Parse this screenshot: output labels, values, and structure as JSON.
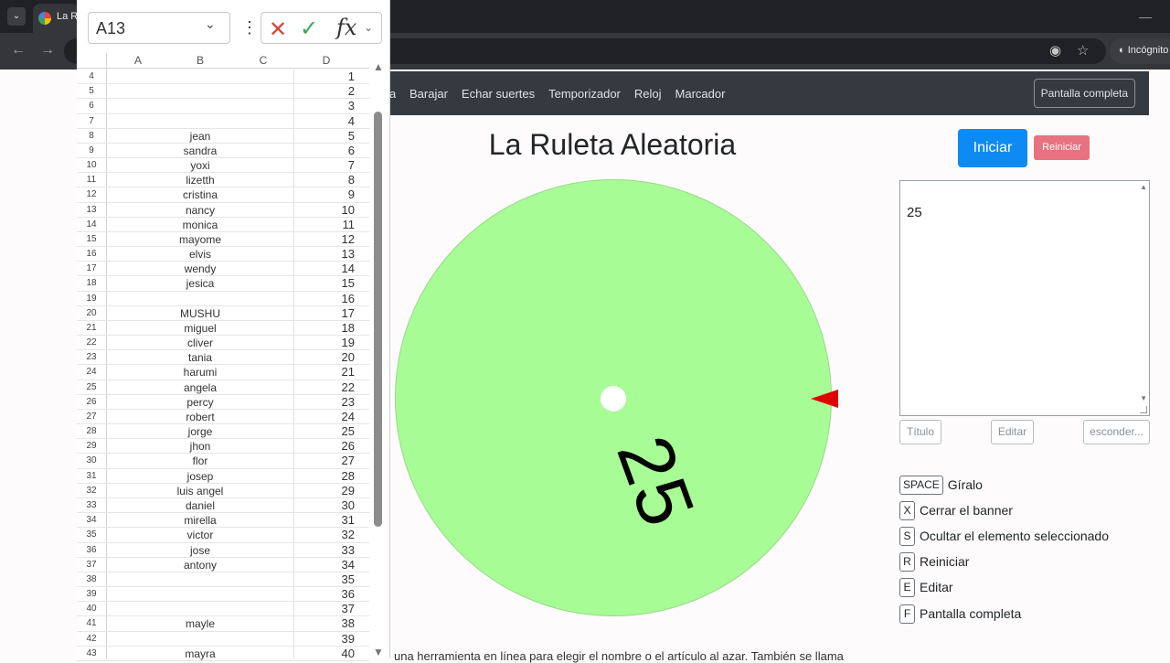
{
  "browser": {
    "tab_title": "La Ru",
    "incognito_label": "Incógnito",
    "minimize_glyph": "—",
    "back_glyph": "←",
    "forward_glyph": "→",
    "tab_list_glyph": "⌄",
    "eye_glyph": "◉",
    "star_glyph": "☆",
    "incognito_glyph": "◐"
  },
  "navbar": {
    "cut_link": "a",
    "links": [
      "Barajar",
      "Echar suertes",
      "Temporizador",
      "Reloj",
      "Marcador"
    ],
    "fullscreen_label": "Pantalla completa"
  },
  "main": {
    "title": "La Ruleta Aleatoria",
    "start_label": "Iniciar",
    "reset_label": "Reiniciar",
    "wheel_label": "25",
    "wheel_color": "#a7fc96",
    "pointer_color": "#e00000",
    "result_text": "25",
    "buttons": {
      "title": "Título",
      "edit": "Editar",
      "hide": "esconder..."
    },
    "shortcuts": [
      {
        "key": "SPACE",
        "text": "Gíralo"
      },
      {
        "key": "X",
        "text": "Cerrar el banner"
      },
      {
        "key": "S",
        "text": "Ocultar el elemento seleccionado"
      },
      {
        "key": "R",
        "text": "Reiniciar"
      },
      {
        "key": "E",
        "text": "Editar"
      },
      {
        "key": "F",
        "text": "Pantalla completa"
      }
    ],
    "bottom_text": "una herramienta en línea para elegir el nombre o el artículo al azar. También se llama"
  },
  "sheet": {
    "namebox": "A13",
    "namebox_caret": "⌄",
    "kebab": "⋮",
    "cancel_glyph": "✕",
    "confirm_glyph": "✓",
    "fx_label": "fx",
    "fx_caret": "⌄",
    "scroll_up": "▲",
    "scroll_down": "▼",
    "columns": [
      "A",
      "B",
      "C",
      "D"
    ],
    "rows": [
      {
        "n": "4",
        "b": "",
        "d": "1"
      },
      {
        "n": "5",
        "b": "",
        "d": "2"
      },
      {
        "n": "6",
        "b": "",
        "d": "3"
      },
      {
        "n": "7",
        "b": "",
        "d": "4"
      },
      {
        "n": "8",
        "b": "jean",
        "d": "5"
      },
      {
        "n": "9",
        "b": "sandra",
        "d": "6"
      },
      {
        "n": "10",
        "b": "yoxi",
        "d": "7"
      },
      {
        "n": "11",
        "b": "lizetth",
        "d": "8"
      },
      {
        "n": "12",
        "b": "cristina",
        "d": "9"
      },
      {
        "n": "13",
        "b": "nancy",
        "d": "10"
      },
      {
        "n": "14",
        "b": "monica",
        "d": "11"
      },
      {
        "n": "15",
        "b": "mayome",
        "d": "12"
      },
      {
        "n": "16",
        "b": "elvis",
        "d": "13"
      },
      {
        "n": "17",
        "b": "wendy",
        "d": "14"
      },
      {
        "n": "18",
        "b": "jesica",
        "d": "15"
      },
      {
        "n": "19",
        "b": "",
        "d": "16"
      },
      {
        "n": "20",
        "b": "MUSHU",
        "d": "17"
      },
      {
        "n": "21",
        "b": "miguel",
        "d": "18"
      },
      {
        "n": "22",
        "b": "cliver",
        "d": "19"
      },
      {
        "n": "23",
        "b": "tania",
        "d": "20"
      },
      {
        "n": "24",
        "b": "harumi",
        "d": "21"
      },
      {
        "n": "25",
        "b": "angela",
        "d": "22"
      },
      {
        "n": "26",
        "b": "percy",
        "d": "23"
      },
      {
        "n": "27",
        "b": "robert",
        "d": "24"
      },
      {
        "n": "28",
        "b": "jorge",
        "d": "25"
      },
      {
        "n": "29",
        "b": "jhon",
        "d": "26"
      },
      {
        "n": "30",
        "b": "flor",
        "d": "27"
      },
      {
        "n": "31",
        "b": "josep",
        "d": "28"
      },
      {
        "n": "32",
        "b": "luis angel",
        "d": "29"
      },
      {
        "n": "33",
        "b": "daniel",
        "d": "30"
      },
      {
        "n": "34",
        "b": "mirella",
        "d": "31"
      },
      {
        "n": "35",
        "b": "victor",
        "d": "32"
      },
      {
        "n": "36",
        "b": "jose",
        "d": "33"
      },
      {
        "n": "37",
        "b": "antony",
        "d": "34"
      },
      {
        "n": "38",
        "b": "",
        "d": "35"
      },
      {
        "n": "39",
        "b": "",
        "d": "36"
      },
      {
        "n": "40",
        "b": "",
        "d": "37"
      },
      {
        "n": "41",
        "b": "mayle",
        "d": "38"
      },
      {
        "n": "42",
        "b": "",
        "d": "39"
      },
      {
        "n": "43",
        "b": "mayra",
        "d": "40"
      }
    ]
  }
}
